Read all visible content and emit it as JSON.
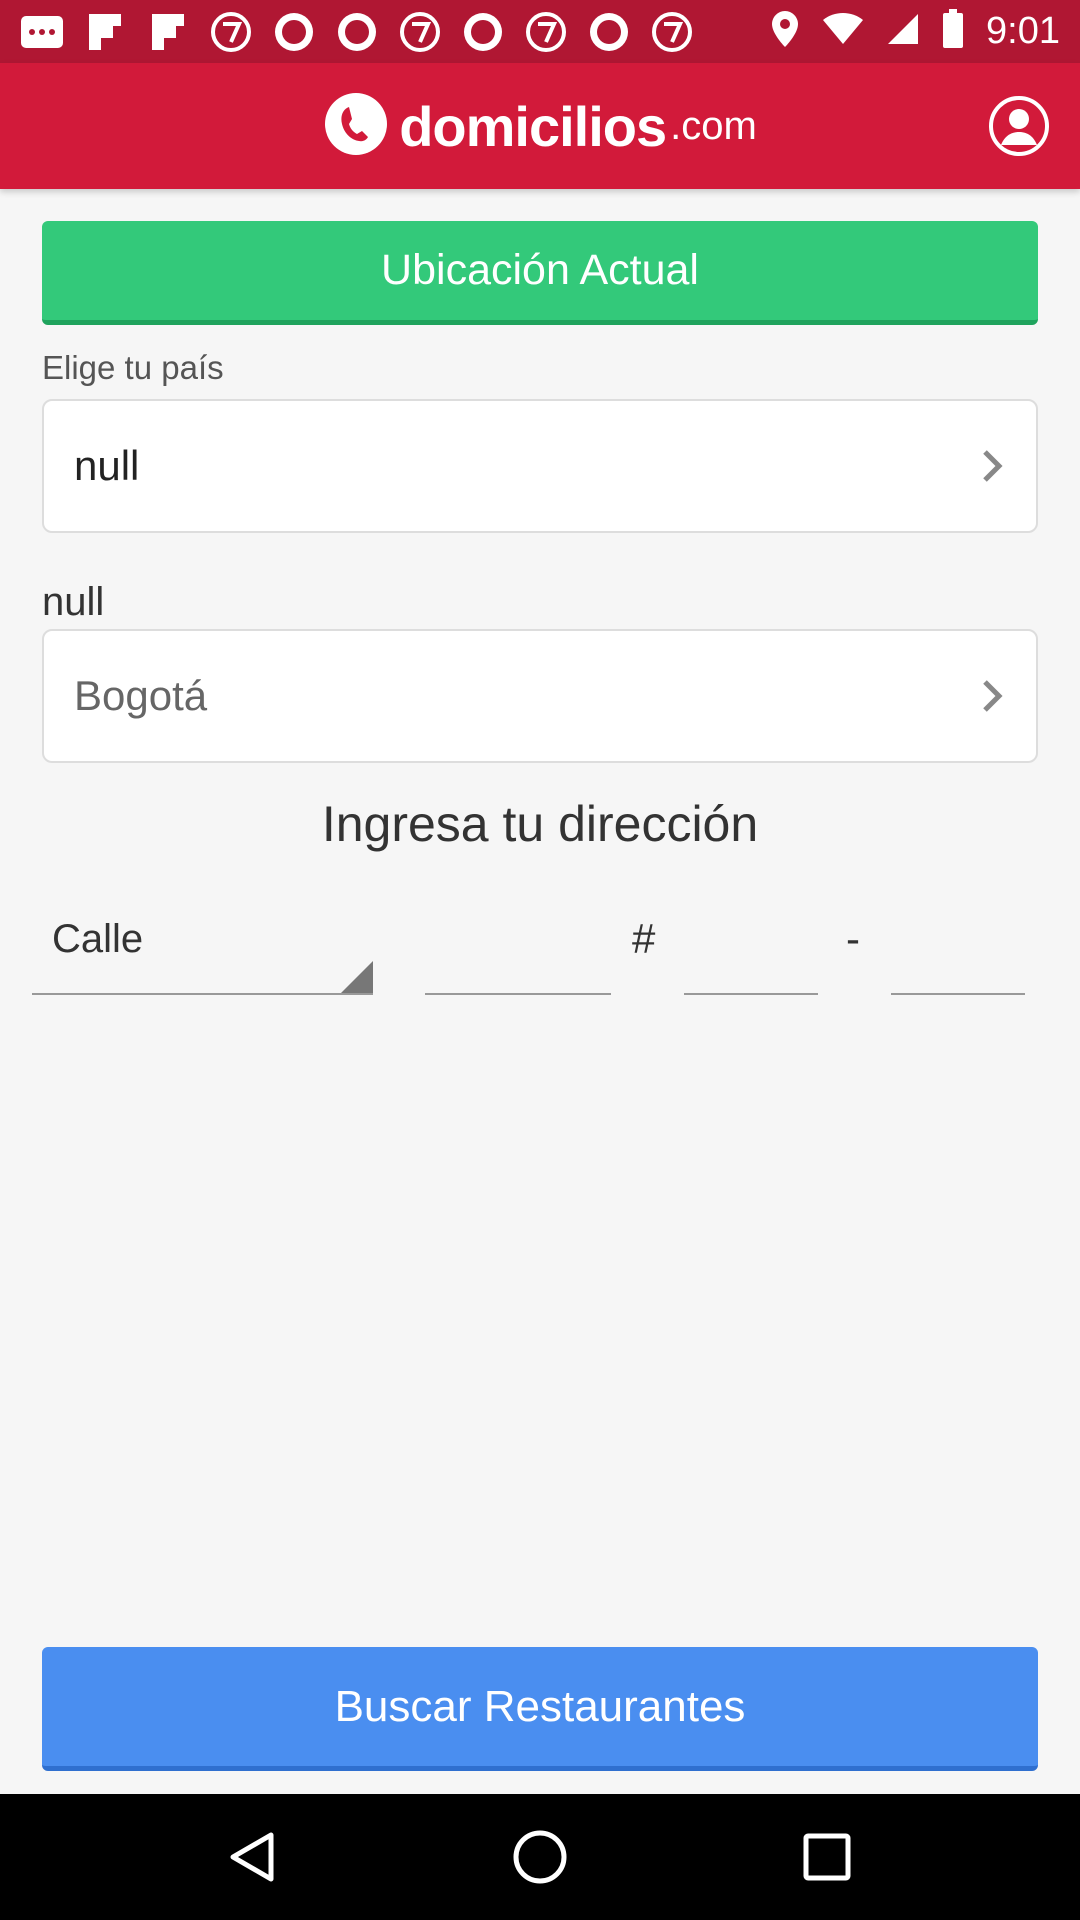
{
  "status_bar": {
    "time": "9:01",
    "notification_icons": [
      "chat-icon",
      "flipboard-icon",
      "flipboard-icon",
      "abc7-icon",
      "abc-icon",
      "abc-icon",
      "abc7-icon",
      "abc-icon",
      "abc7-icon",
      "abc-icon",
      "abc7-icon"
    ]
  },
  "header": {
    "logo_main": "domicilios",
    "logo_suffix": ".com"
  },
  "location_button": "Ubicación Actual",
  "country": {
    "label": "Elige tu país",
    "value": "null"
  },
  "city": {
    "label": "null",
    "value": "Bogotá"
  },
  "address": {
    "heading": "Ingresa tu dirección",
    "street_type": "Calle",
    "hash_symbol": "#",
    "dash_symbol": "-",
    "field1_value": "",
    "field2_value": "",
    "field3_value": ""
  },
  "search_button": "Buscar Restaurantes",
  "colors": {
    "brand_red": "#d21a3a",
    "green": "#33c97a",
    "blue": "#4a8ef0"
  }
}
